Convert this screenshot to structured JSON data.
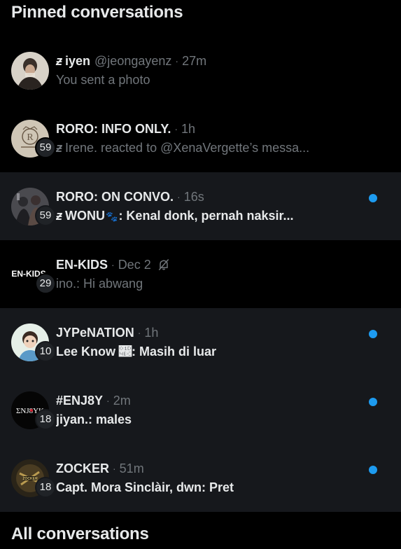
{
  "pinned_header": "Pinned conversations",
  "all_header": "All conversations",
  "colors": {
    "background": "#000000",
    "highlight_row": "#16181c",
    "unread_dot": "#1d9bf0",
    "muted_text": "#71767b",
    "primary_text": "#e7e9ea"
  },
  "conversations": [
    {
      "name": "iyen",
      "glyph": "ƶ",
      "handle": "@jeongayenz",
      "sep": "·",
      "time": "27m",
      "preview": "You sent a photo",
      "avatar": "photo-portrait-avatar"
    },
    {
      "name": "RORO: INFO ONLY.",
      "sep": "·",
      "time": "1h",
      "badge": "59",
      "preview_glyph": "ƶ",
      "preview": "Irene. reacted to @XenaVergette’s messa...",
      "avatar": "crest-logo-avatar"
    },
    {
      "name": "RORO: ON CONVO.",
      "sep": "·",
      "time": "16s",
      "badge": "59",
      "preview_glyph": "ƶ",
      "preview_sender": "WONU",
      "preview_paw": "🐾",
      "preview": ": Kenal donk, pernah naksir...",
      "unread": true,
      "avatar": "group-photo-avatar"
    },
    {
      "name": "EN-KIDS",
      "sep": "·",
      "time": "Dec 2",
      "badge": "29",
      "preview": "ino.: Hi abwang",
      "muted": true,
      "avatar_text": "EN-KIDS",
      "avatar": "enkids-logo-avatar"
    },
    {
      "name": "JYPeNATION",
      "sep": "·",
      "time": "1h",
      "badge": "10",
      "preview": "Lee Know 𝒼: Masih di luar",
      "unread": true,
      "avatar": "cartoon-avatar"
    },
    {
      "name": "#ENJ8Y",
      "sep": "·",
      "time": "2m",
      "badge": "18",
      "preview": "jiyan.: males",
      "unread": true,
      "avatar_text": "ΣNJ8YK",
      "avatar": "enjoy-logo-avatar"
    },
    {
      "name": "ZOCKER",
      "sep": "·",
      "time": "51m",
      "badge": "18",
      "preview": "Capt. Mora Sinclàir, dwn: Pret",
      "unread": true,
      "avatar": "zocker-logo-avatar"
    }
  ]
}
